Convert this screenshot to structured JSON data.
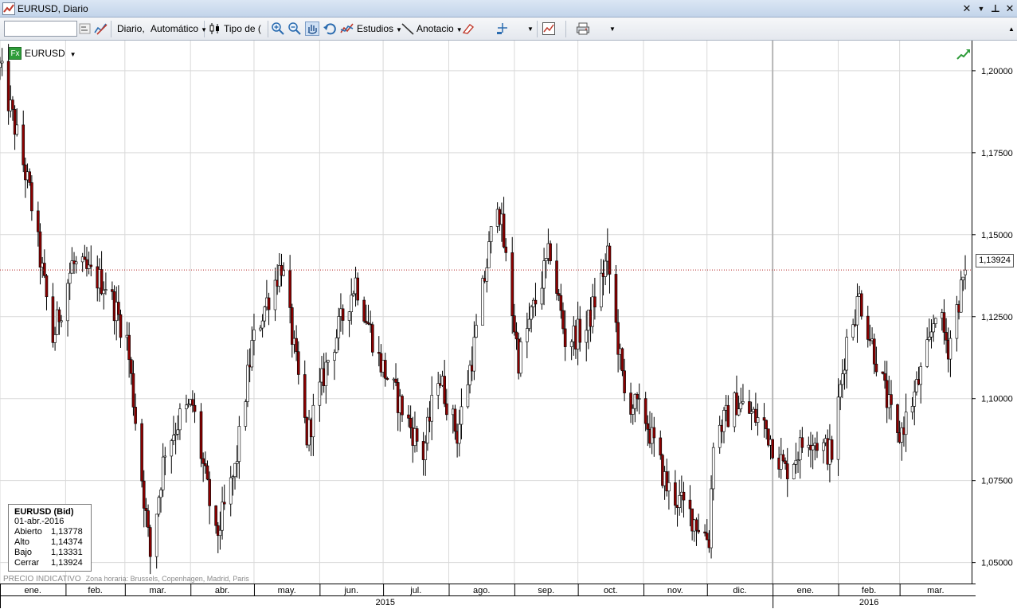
{
  "window": {
    "title": "EURUSD, Diario"
  },
  "toolbar": {
    "symbol_value": "",
    "period_label": "Diario,",
    "scale_label": "Automático",
    "chart_type_label": "Tipo de (",
    "studies_label": "Estudios",
    "annotation_label": "Anotacio"
  },
  "chart_header": {
    "symbol": "EURUSD"
  },
  "info_box": {
    "title": "EURUSD (Bid)",
    "date": "01-abr.-2016",
    "rows": [
      {
        "label": "Abierto",
        "value": "1,13778"
      },
      {
        "label": "Alto",
        "value": "1,14374"
      },
      {
        "label": "Bajo",
        "value": "1,13331"
      },
      {
        "label": "Cerrar",
        "value": "1,13924"
      }
    ]
  },
  "footer": {
    "note": "PRECIO INDICATIVO",
    "timezone": "Zona horaria: Brussels, Copenhagen, Madrid, Paris"
  },
  "current_price_label": "1,13924",
  "colors": {
    "up": "#ffffff",
    "down": "#8b0000",
    "wick": "#000000",
    "grid": "#d9d9d9",
    "current_price_line": "#b22222"
  },
  "chart_data": {
    "type": "candlestick",
    "title": "",
    "xlabel": "",
    "ylabel": "",
    "y_ticks": [
      {
        "value": 1.2,
        "label": "1,20000"
      },
      {
        "value": 1.175,
        "label": "1,17500"
      },
      {
        "value": 1.15,
        "label": "1,15000"
      },
      {
        "value": 1.125,
        "label": "1,12500"
      },
      {
        "value": 1.1,
        "label": "1,10000"
      },
      {
        "value": 1.075,
        "label": "1,07500"
      },
      {
        "value": 1.05,
        "label": "1,05000"
      }
    ],
    "ylim": [
      1.0436,
      1.2092
    ],
    "months": [
      {
        "label": "ene.",
        "start": "2015-01-01"
      },
      {
        "label": "feb.",
        "start": "2015-02-01"
      },
      {
        "label": "mar.",
        "start": "2015-03-01"
      },
      {
        "label": "abr.",
        "start": "2015-04-01"
      },
      {
        "label": "may.",
        "start": "2015-05-01"
      },
      {
        "label": "jun.",
        "start": "2015-06-01"
      },
      {
        "label": "jul.",
        "start": "2015-07-01"
      },
      {
        "label": "ago.",
        "start": "2015-08-01"
      },
      {
        "label": "sep.",
        "start": "2015-09-01"
      },
      {
        "label": "oct.",
        "start": "2015-10-01"
      },
      {
        "label": "nov.",
        "start": "2015-11-01"
      },
      {
        "label": "dic.",
        "start": "2015-12-01"
      },
      {
        "label": "ene.",
        "start": "2016-01-01"
      },
      {
        "label": "feb.",
        "start": "2016-02-01"
      },
      {
        "label": "mar.",
        "start": "2016-03-01"
      }
    ],
    "years": [
      {
        "label": "2015",
        "start": "2015-01-01",
        "end": "2015-12-31"
      },
      {
        "label": "2016",
        "start": "2016-01-01",
        "end": "2016-04-01"
      }
    ],
    "current_price": 1.13924,
    "key_points": [
      {
        "date": "2015-01-01",
        "price": 1.201
      },
      {
        "date": "2015-01-08",
        "price": 1.183
      },
      {
        "date": "2015-01-15",
        "price": 1.163
      },
      {
        "date": "2015-01-26",
        "price": 1.118
      },
      {
        "date": "2015-02-04",
        "price": 1.141
      },
      {
        "date": "2015-02-20",
        "price": 1.135
      },
      {
        "date": "2015-03-02",
        "price": 1.118
      },
      {
        "date": "2015-03-13",
        "price": 1.052
      },
      {
        "date": "2015-03-20",
        "price": 1.085
      },
      {
        "date": "2015-03-27",
        "price": 1.094
      },
      {
        "date": "2015-04-02",
        "price": 1.098
      },
      {
        "date": "2015-04-13",
        "price": 1.057
      },
      {
        "date": "2015-04-22",
        "price": 1.078
      },
      {
        "date": "2015-04-30",
        "price": 1.116
      },
      {
        "date": "2015-05-06",
        "price": 1.128
      },
      {
        "date": "2015-05-14",
        "price": 1.141
      },
      {
        "date": "2015-05-26",
        "price": 1.088
      },
      {
        "date": "2015-06-05",
        "price": 1.112
      },
      {
        "date": "2015-06-18",
        "price": 1.136
      },
      {
        "date": "2015-06-29",
        "price": 1.112
      },
      {
        "date": "2015-07-07",
        "price": 1.101
      },
      {
        "date": "2015-07-20",
        "price": 1.083
      },
      {
        "date": "2015-07-27",
        "price": 1.108
      },
      {
        "date": "2015-08-05",
        "price": 1.089
      },
      {
        "date": "2015-08-13",
        "price": 1.116
      },
      {
        "date": "2015-08-24",
        "price": 1.162
      },
      {
        "date": "2015-09-03",
        "price": 1.112
      },
      {
        "date": "2015-09-18",
        "price": 1.145
      },
      {
        "date": "2015-09-25",
        "price": 1.118
      },
      {
        "date": "2015-10-05",
        "price": 1.121
      },
      {
        "date": "2015-10-15",
        "price": 1.143
      },
      {
        "date": "2015-10-23",
        "price": 1.101
      },
      {
        "date": "2015-11-02",
        "price": 1.094
      },
      {
        "date": "2015-11-12",
        "price": 1.073
      },
      {
        "date": "2015-11-24",
        "price": 1.064
      },
      {
        "date": "2015-12-02",
        "price": 1.057
      },
      {
        "date": "2015-12-04",
        "price": 1.088
      },
      {
        "date": "2015-12-15",
        "price": 1.099
      },
      {
        "date": "2015-12-28",
        "price": 1.092
      },
      {
        "date": "2016-01-07",
        "price": 1.078
      },
      {
        "date": "2016-01-18",
        "price": 1.089
      },
      {
        "date": "2016-01-29",
        "price": 1.083
      },
      {
        "date": "2016-02-05",
        "price": 1.118
      },
      {
        "date": "2016-02-11",
        "price": 1.131
      },
      {
        "date": "2016-02-19",
        "price": 1.112
      },
      {
        "date": "2016-02-29",
        "price": 1.087
      },
      {
        "date": "2016-03-08",
        "price": 1.101
      },
      {
        "date": "2016-03-15",
        "price": 1.116
      },
      {
        "date": "2016-03-18",
        "price": 1.128
      },
      {
        "date": "2016-03-24",
        "price": 1.116
      },
      {
        "date": "2016-04-01",
        "price": 1.139
      }
    ],
    "last_candle": {
      "date": "2016-04-01",
      "open": 1.13778,
      "high": 1.14374,
      "low": 1.13331,
      "close": 1.13924
    }
  }
}
